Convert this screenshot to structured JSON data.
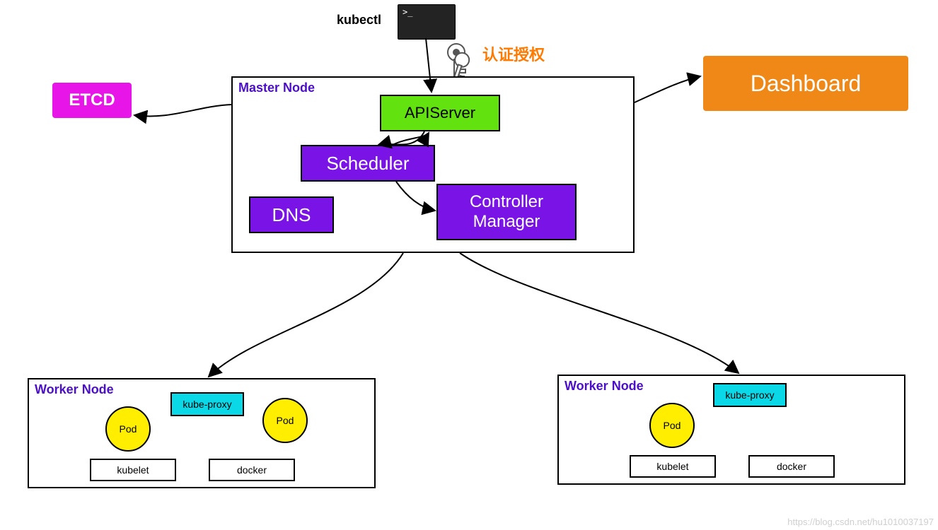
{
  "kubectl_label": "kubectl",
  "auth_label": "认证授权",
  "etcd": "ETCD",
  "dashboard": "Dashboard",
  "master": {
    "title": "Master Node",
    "apiserver": "APIServer",
    "scheduler": "Scheduler",
    "dns": "DNS",
    "controller_manager": "Controller Manager"
  },
  "worker1": {
    "title": "Worker Node",
    "kube_proxy": "kube-proxy",
    "pod1": "Pod",
    "pod2": "Pod",
    "kubelet": "kubelet",
    "docker": "docker"
  },
  "worker2": {
    "title": "Worker Node",
    "kube_proxy": "kube-proxy",
    "pod1": "Pod",
    "kubelet": "kubelet",
    "docker": "docker"
  },
  "watermark": "https://blog.csdn.net/hu1010037197",
  "colors": {
    "purple": "#7a14e6",
    "green": "#62e20f",
    "magenta": "#e815e8",
    "orange_box": "#f08817",
    "orange_text": "#ff7a00",
    "cyan": "#0bd8e6",
    "yellow": "#ffee00",
    "title": "#4b0ec9"
  }
}
